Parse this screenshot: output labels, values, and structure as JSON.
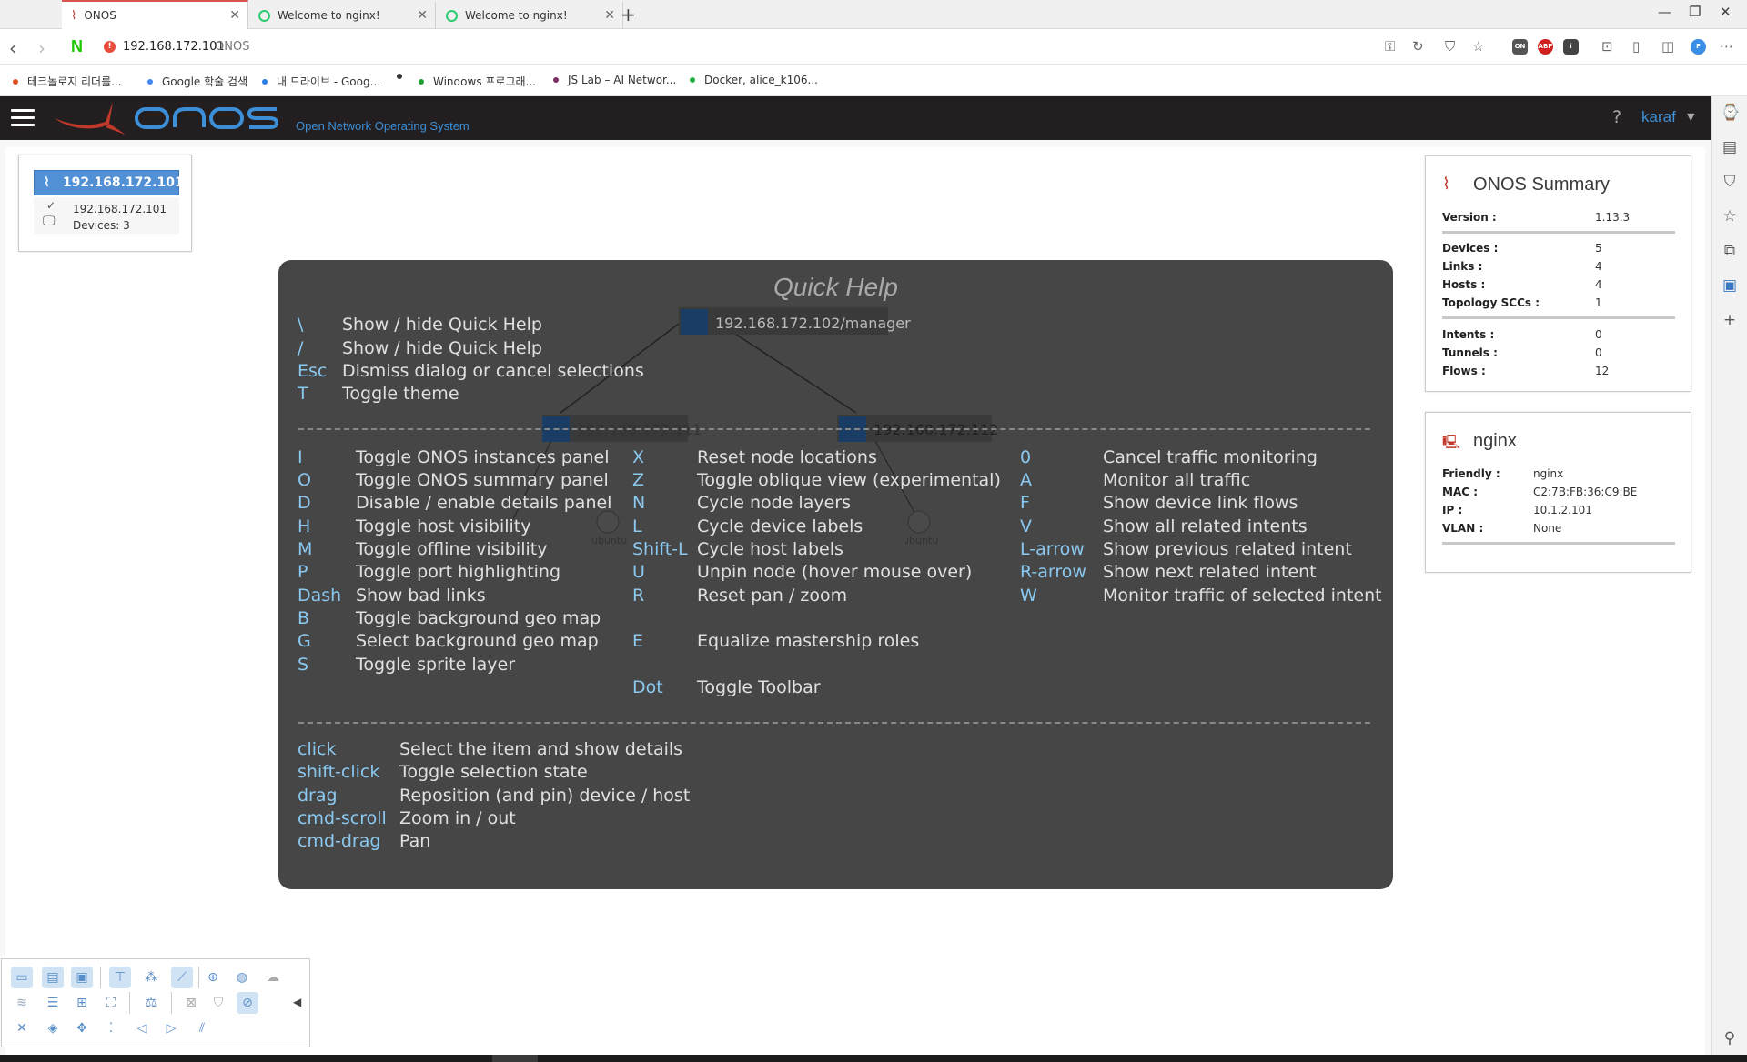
{
  "browser": {
    "tabs": [
      {
        "title": "ONOS",
        "active": true
      },
      {
        "title": "Welcome to nginx!",
        "active": false
      },
      {
        "title": "Welcome to nginx!",
        "active": false
      }
    ],
    "address": {
      "url": "192.168.172.101",
      "page_title": "ONOS"
    },
    "bookmarks": [
      {
        "label": "테크놀로지 리더를...",
        "color": "#e05020"
      },
      {
        "label": "Google 학술 검색",
        "color": "#4285f4"
      },
      {
        "label": "내 드라이브 - Goog...",
        "color": "#2b7de9"
      },
      {
        "label": "",
        "color": "#333333"
      },
      {
        "label": "Windows 프로그래...",
        "color": "#20a030"
      },
      {
        "label": "JS Lab – AI Networ...",
        "color": "#7a3060"
      },
      {
        "label": "Docker, alice_k106...",
        "color": "#20b040"
      }
    ]
  },
  "masthead": {
    "logo": "ONOS",
    "subtitle": "Open Network Operating System",
    "help": "?",
    "user": "karaf"
  },
  "instances": {
    "header": "192.168.172.101",
    "ip": "192.168.172.101",
    "devices": "Devices: 3"
  },
  "summary": {
    "title": "ONOS Summary",
    "version_label": "Version :",
    "version": "1.13.3",
    "devices_label": "Devices :",
    "devices": "5",
    "links_label": "Links :",
    "links": "4",
    "hosts_label": "Hosts :",
    "hosts": "4",
    "sccs_label": "Topology SCCs :",
    "sccs": "1",
    "intents_label": "Intents :",
    "intents": "0",
    "tunnels_label": "Tunnels :",
    "tunnels": "0",
    "flows_label": "Flows :",
    "flows": "12"
  },
  "details": {
    "title": "nginx",
    "friendly_label": "Friendly :",
    "friendly": "nginx",
    "mac_label": "MAC :",
    "mac": "C2:7B:FB:36:C9:BE",
    "ip_label": "IP :",
    "ip": "10.1.2.101",
    "vlan_label": "VLAN :",
    "vlan": "None"
  },
  "topology": {
    "nodes": [
      "192.168.172.102/manager",
      "192.168.172.111",
      "192.168.172.112"
    ],
    "hosts": [
      "ubuntu",
      "ubuntu"
    ]
  },
  "quick_help": {
    "title": "Quick Help",
    "general": [
      {
        "key": "\\",
        "desc": "Show / hide Quick Help"
      },
      {
        "key": "/",
        "desc": "Show / hide Quick Help"
      },
      {
        "key": "Esc",
        "desc": "Dismiss dialog or cancel selections"
      },
      {
        "key": "T",
        "desc": "Toggle theme"
      }
    ],
    "col1": [
      {
        "key": "I",
        "desc": "Toggle ONOS instances panel"
      },
      {
        "key": "O",
        "desc": "Toggle ONOS summary panel"
      },
      {
        "key": "D",
        "desc": "Disable / enable details panel"
      },
      {
        "key": "H",
        "desc": "Toggle host visibility"
      },
      {
        "key": "M",
        "desc": "Toggle offline visibility"
      },
      {
        "key": "P",
        "desc": "Toggle port highlighting"
      },
      {
        "key": "Dash",
        "desc": "Show bad links"
      },
      {
        "key": "B",
        "desc": "Toggle background geo map"
      },
      {
        "key": "G",
        "desc": "Select background geo map"
      },
      {
        "key": "S",
        "desc": "Toggle sprite layer"
      }
    ],
    "col2": [
      {
        "key": "X",
        "desc": "Reset node locations"
      },
      {
        "key": "Z",
        "desc": "Toggle oblique view (experimental)"
      },
      {
        "key": "N",
        "desc": "Cycle node layers"
      },
      {
        "key": "L",
        "desc": "Cycle device labels"
      },
      {
        "key": "Shift-L",
        "desc": "Cycle host labels"
      },
      {
        "key": "U",
        "desc": "Unpin node (hover mouse over)"
      },
      {
        "key": "R",
        "desc": "Reset pan / zoom"
      },
      {
        "key": "E",
        "desc": "Equalize mastership roles"
      },
      {
        "key": "Dot",
        "desc": "Toggle Toolbar"
      }
    ],
    "col3": [
      {
        "key": "0",
        "desc": "Cancel traffic monitoring"
      },
      {
        "key": "A",
        "desc": "Monitor all traffic"
      },
      {
        "key": "F",
        "desc": "Show device link flows"
      },
      {
        "key": "V",
        "desc": "Show all related intents"
      },
      {
        "key": "L-arrow",
        "desc": "Show previous related intent"
      },
      {
        "key": "R-arrow",
        "desc": "Show next related intent"
      },
      {
        "key": "W",
        "desc": "Monitor traffic of selected intent"
      }
    ],
    "mouse": [
      {
        "key": "click",
        "desc": "Select the item and show details"
      },
      {
        "key": "shift-click",
        "desc": "Toggle selection state"
      },
      {
        "key": "drag",
        "desc": "Reposition (and pin) device / host"
      },
      {
        "key": "cmd-scroll",
        "desc": "Zoom in / out"
      },
      {
        "key": "cmd-drag",
        "desc": "Pan"
      }
    ]
  },
  "colors": {
    "accent": "#3c8fd6",
    "masthead": "#231f20",
    "help_key": "#8ac8f0",
    "instance_highlight": "#5290d6"
  }
}
